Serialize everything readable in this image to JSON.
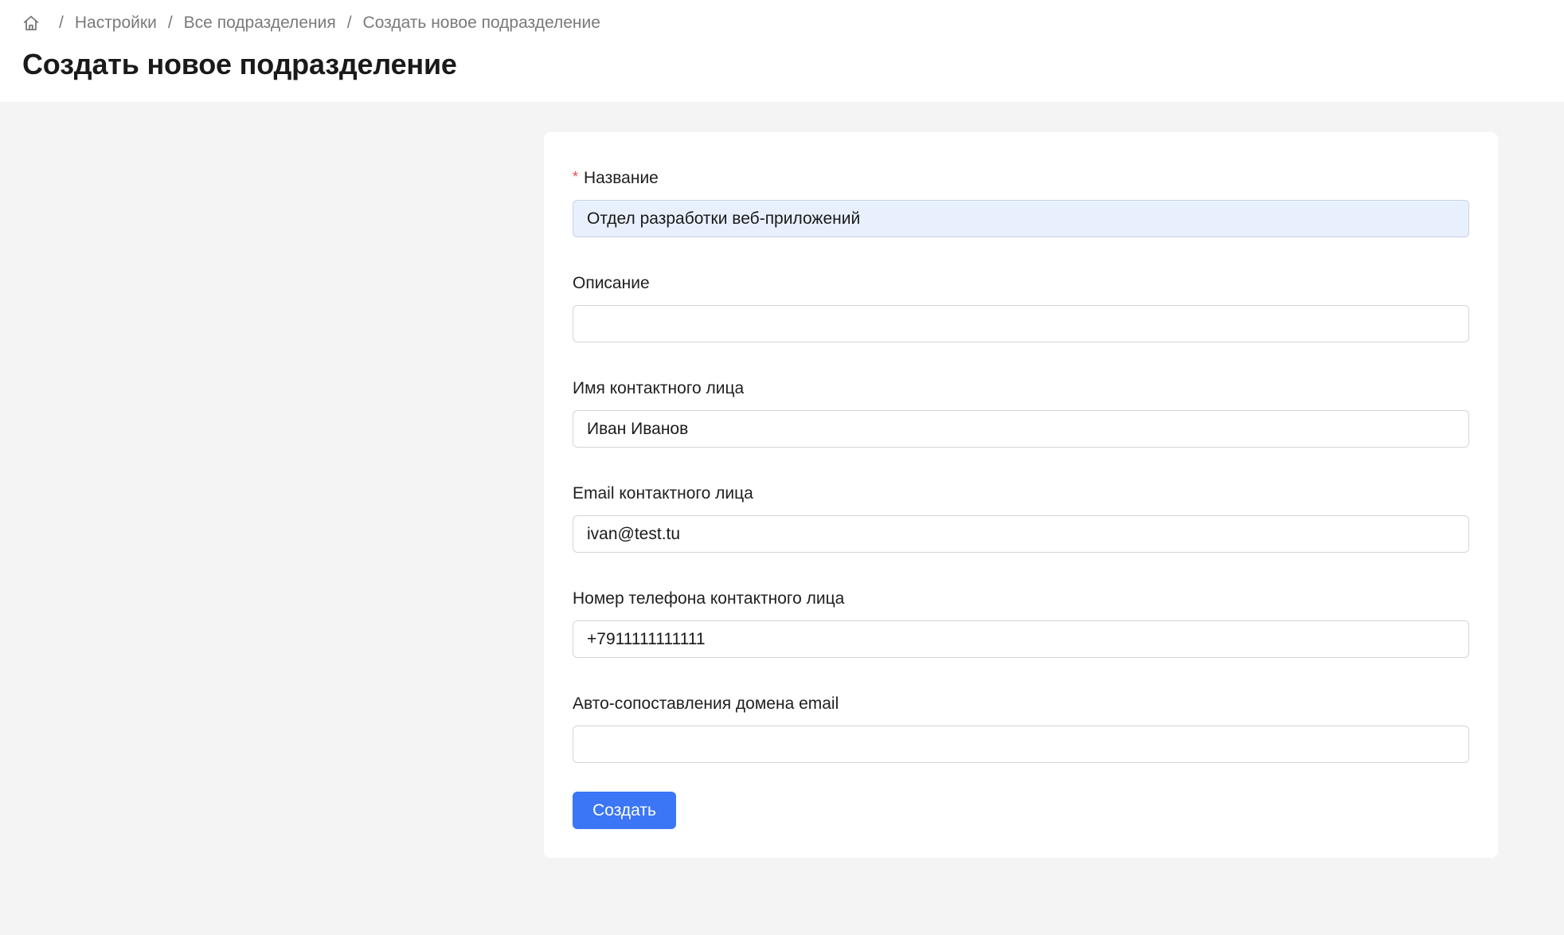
{
  "breadcrumb": {
    "items": [
      "Настройки",
      "Все подразделения"
    ],
    "current": "Создать новое подразделение",
    "separator": "/"
  },
  "page": {
    "title": "Создать новое подразделение"
  },
  "form": {
    "name": {
      "label": "Название",
      "required_mark": "*",
      "value": "Отдел разработки веб-приложений"
    },
    "description": {
      "label": "Описание",
      "value": ""
    },
    "contact_name": {
      "label": "Имя контактного лица",
      "value": "Иван Иванов"
    },
    "contact_email": {
      "label": "Email контактного лица",
      "value": "ivan@test.tu"
    },
    "contact_phone": {
      "label": "Номер телефона контактного лица",
      "value": "+7911111111111"
    },
    "email_domain_mapping": {
      "label": "Авто-сопоставления домена email",
      "value": ""
    },
    "submit_label": "Создать"
  },
  "colors": {
    "accent": "#3b76f6",
    "required": "#e5484d",
    "autofill_bg": "#e8f0fe",
    "page_bg": "#f4f4f4"
  },
  "icons": {
    "home": "home-icon"
  }
}
